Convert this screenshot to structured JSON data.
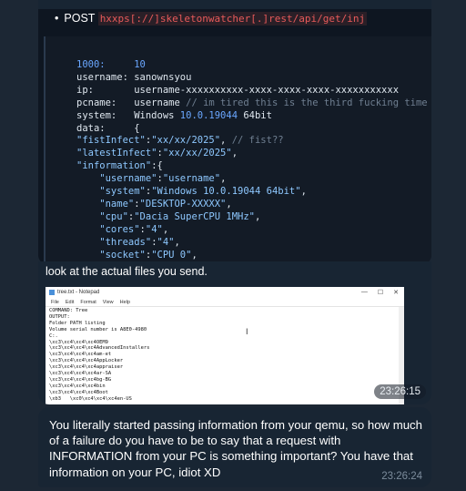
{
  "code_message": {
    "bullet": "•",
    "method": "POST",
    "url": "hxxps[://]skeletonwatcher[.]rest/api/get/inj",
    "lines": [
      [
        {
          "t": "1000:     ",
          "c": "c-blue"
        },
        {
          "t": "10",
          "c": "c-blue"
        }
      ],
      [
        {
          "t": "username: ",
          "c": "c-plain"
        },
        {
          "t": "sanownsyou",
          "c": "c-plain"
        }
      ],
      [
        {
          "t": "ip:       ",
          "c": "c-plain"
        },
        {
          "t": "username-xxxxxxxxxx-xxxx-xxxx-xxxx-xxxxxxxxxxx",
          "c": "c-plain"
        }
      ],
      [
        {
          "t": "pcname:   ",
          "c": "c-plain"
        },
        {
          "t": "username ",
          "c": "c-plain"
        },
        {
          "t": "// im tired this is the third fucking time",
          "c": "c-comment"
        }
      ],
      [
        {
          "t": "system:   ",
          "c": "c-plain"
        },
        {
          "t": "Windows ",
          "c": "c-plain"
        },
        {
          "t": "10.0.19044",
          "c": "c-blue"
        },
        {
          "t": " 64bit",
          "c": "c-plain"
        }
      ],
      [
        {
          "t": "data:     {",
          "c": "c-plain"
        }
      ],
      [
        {
          "t": "\"fistInfect\"",
          "c": "c-str"
        },
        {
          "t": ":",
          "c": "c-plain"
        },
        {
          "t": "\"xx/xx/2025\"",
          "c": "c-str"
        },
        {
          "t": ", ",
          "c": "c-plain"
        },
        {
          "t": "// fist??",
          "c": "c-comment"
        }
      ],
      [
        {
          "t": "\"latestInfect\"",
          "c": "c-str"
        },
        {
          "t": ":",
          "c": "c-plain"
        },
        {
          "t": "\"xx/xx/2025\"",
          "c": "c-str"
        },
        {
          "t": ",",
          "c": "c-plain"
        }
      ],
      [
        {
          "t": "\"information\"",
          "c": "c-str"
        },
        {
          "t": ":{",
          "c": "c-plain"
        }
      ],
      [
        {
          "t": "    \"username\"",
          "c": "c-str"
        },
        {
          "t": ":",
          "c": "c-plain"
        },
        {
          "t": "\"username\"",
          "c": "c-str"
        },
        {
          "t": ",",
          "c": "c-plain"
        }
      ],
      [
        {
          "t": "    \"system\"",
          "c": "c-str"
        },
        {
          "t": ":",
          "c": "c-plain"
        },
        {
          "t": "\"Windows 10.0.19044 64bit\"",
          "c": "c-str"
        },
        {
          "t": ",",
          "c": "c-plain"
        }
      ],
      [
        {
          "t": "    \"name\"",
          "c": "c-str"
        },
        {
          "t": ":",
          "c": "c-plain"
        },
        {
          "t": "\"DESKTOP-XXXXX\"",
          "c": "c-str"
        },
        {
          "t": ",",
          "c": "c-plain"
        }
      ],
      [
        {
          "t": "    \"cpu\"",
          "c": "c-str"
        },
        {
          "t": ":",
          "c": "c-plain"
        },
        {
          "t": "\"Dacia SuperCPU 1MHz\"",
          "c": "c-str"
        },
        {
          "t": ",",
          "c": "c-plain"
        }
      ],
      [
        {
          "t": "    \"cores\"",
          "c": "c-str"
        },
        {
          "t": ":",
          "c": "c-plain"
        },
        {
          "t": "\"4\"",
          "c": "c-str"
        },
        {
          "t": ",",
          "c": "c-plain"
        }
      ],
      [
        {
          "t": "    \"threads\"",
          "c": "c-str"
        },
        {
          "t": ":",
          "c": "c-plain"
        },
        {
          "t": "\"4\"",
          "c": "c-str"
        },
        {
          "t": ",",
          "c": "c-plain"
        }
      ],
      [
        {
          "t": "    \"socket\"",
          "c": "c-str"
        },
        {
          "t": ":",
          "c": "c-plain"
        },
        {
          "t": "\"CPU 0\"",
          "c": "c-str"
        },
        {
          "t": ",",
          "c": "c-plain"
        }
      ]
    ]
  },
  "image_message": {
    "caption": "look at the actual files you send.",
    "notepad_title": "tree.txt - Notepad",
    "notepad_controls": [
      "—",
      "☐",
      "✕"
    ],
    "notepad_menu": [
      "File",
      "Edit",
      "Format",
      "View",
      "Help"
    ],
    "notepad_text": "COMMAND: Tree\nOUTPUT:\nFolder PATH listing\nVolume serial number is A8E0-4980\nC:.\n\\xc3\\xc4\\xc4\\xc4OEM9\n\\xc3\\xc4\\xc4\\xc4AdvancedInstallers\n\\xc3\\xc4\\xc4\\xc4am-et\n\\xc3\\xc4\\xc4\\xc4AppLocker\n\\xc3\\xc4\\xc4\\xc4appraiser\n\\xc3\\xc4\\xc4\\xc4ar-SA\n\\xc3\\xc4\\xc4\\xc4bg-BG\n\\xc3\\xc4\\xc4\\xc4bin\n\\xc3\\xc4\\xc4\\xc4Boot\n\\xb3   \\xc0\\xc4\\xc4\\xc4en-US",
    "time": "23:26:15"
  },
  "text_message": {
    "text": "You literally started passing information from your qemu, so how much of a failure do you have to be to say that a request with INFORMATION from your PC is something important? You have that information on your PC, idiot XD",
    "time": "23:26:24"
  }
}
